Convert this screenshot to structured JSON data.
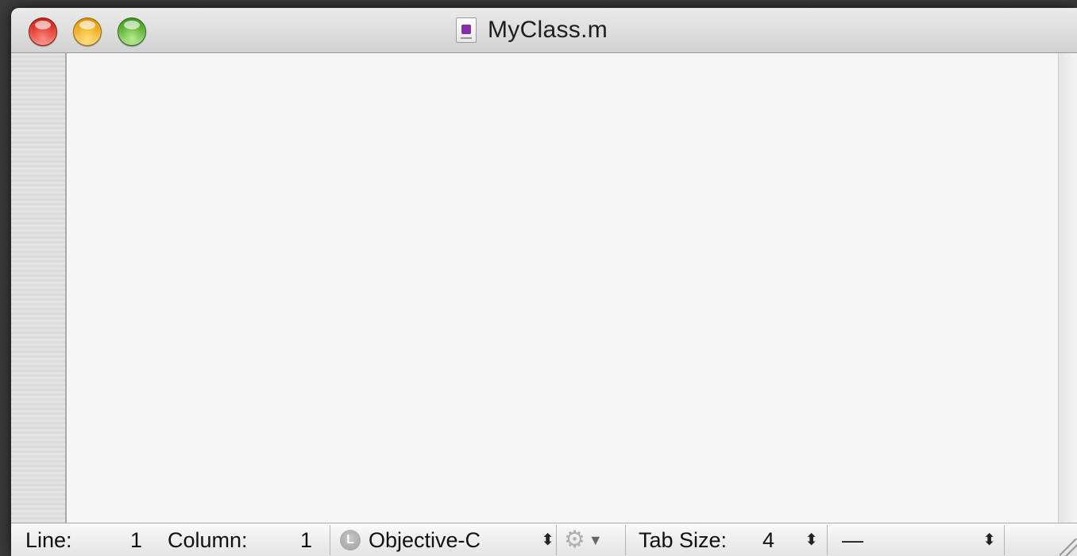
{
  "window": {
    "title": "MyClass.m",
    "file_icon": "objective-c-source-file-icon"
  },
  "statusbar": {
    "line_label": "Line:",
    "line_value": "1",
    "column_label": "Column:",
    "column_value": "1",
    "language_badge": "L",
    "language": "Objective-C",
    "stepper_glyph": "⬍",
    "gear_glyph": "⚙",
    "chevron_glyph": "▼",
    "tab_size_label": "Tab Size:",
    "tab_size_value": "4",
    "symbol_popup": "—"
  }
}
